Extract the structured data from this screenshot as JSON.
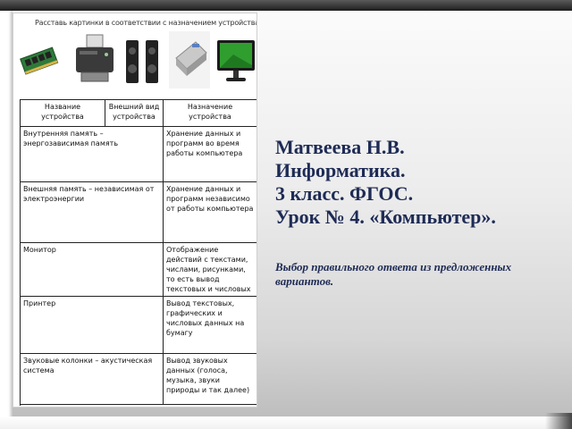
{
  "slide": {
    "title_lines": [
      "Матвеева Н.В.",
      "Информатика.",
      "3 класс. ФГОС.",
      "Урок № 4. «Компьютер»."
    ],
    "subtitle": "Выбор правильного ответа из предложенных вариантов."
  },
  "worksheet": {
    "caption": "Расставь картинки в соответствии с назначением устройства.",
    "device_icons": [
      "memory-module-icon",
      "printer-icon",
      "speakers-icon",
      "scanner-icon",
      "monitor-icon"
    ],
    "table": {
      "headers": [
        "Название устройства",
        "Внешний вид устройства",
        "Назначение устройства"
      ],
      "rows": [
        {
          "name": "Внутренняя память – энергозависимая память",
          "purpose": "Хранение данных и программ во время работы компьютера"
        },
        {
          "name": "Внешняя память – независимая от электроэнергии",
          "purpose": "Хранение данных и программ независимо от работы компьютера"
        },
        {
          "name": "Монитор",
          "purpose": "Отображение действий с текстами, числами, рисунками, то есть вывод текстовых и числовых графических данных"
        },
        {
          "name": "Принтер",
          "purpose": "Вывод текстовых, графических и числовых данных на бумагу"
        },
        {
          "name": "Звуковые колонки – акустическая система",
          "purpose": "Вывод звуковых данных (голоса, музыка, звуки природы и так далее)"
        }
      ]
    }
  },
  "colors": {
    "title": "#1e2b55",
    "grid": "#222222"
  }
}
